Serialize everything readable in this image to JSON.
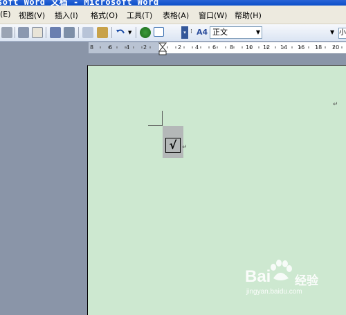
{
  "window": {
    "title": "soft Word 文档 - Microsoft Word"
  },
  "menu": {
    "items": [
      {
        "label": "(E)"
      },
      {
        "label": "视图(V)"
      },
      {
        "label": "插入(I)"
      },
      {
        "label": "格式(O)"
      },
      {
        "label": "工具(T)"
      },
      {
        "label": "表格(A)"
      },
      {
        "label": "窗口(W)"
      },
      {
        "label": "帮助(H)"
      }
    ]
  },
  "toolbar": {
    "style_value": "正文",
    "style_icon_label": "A4",
    "trailing_label": "小"
  },
  "ruler": {
    "labels": [
      "8",
      "6",
      "4",
      "2",
      "2",
      "4",
      "6",
      "8",
      "10",
      "12",
      "14",
      "16",
      "18",
      "20"
    ]
  },
  "document": {
    "checkbox_glyph": "√",
    "paragraph_mark": "↵"
  },
  "watermark": {
    "brand": "Bai",
    "brand_suffix": "经验",
    "url": "jingyan.baidu.com"
  },
  "colors": {
    "page_bg": "#cde8d0",
    "titlebar": "#0b4fc9",
    "menubar": "#edeadf"
  }
}
